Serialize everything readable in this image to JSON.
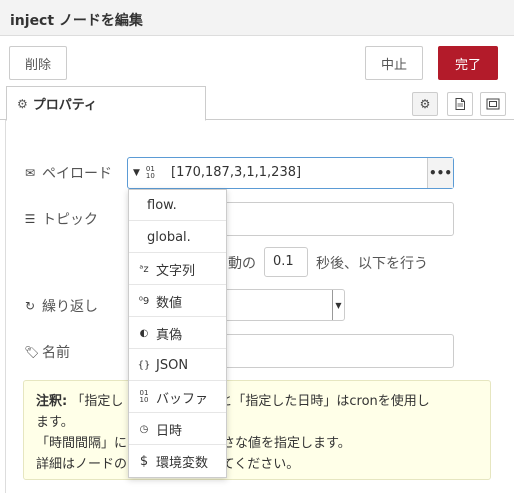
{
  "dialog": {
    "title": "inject ノードを編集"
  },
  "toolbar": {
    "delete_label": "削除",
    "cancel_label": "中止",
    "done_label": "完了"
  },
  "tabs": {
    "properties_label": "プロパティ"
  },
  "form": {
    "payload_label": "ペイロード",
    "payload_value": "[170,187,3,1,1,238]",
    "payload_type_icon": "binary-icon",
    "topic_label": "トピック",
    "delay_prefix": "動の",
    "delay_value": "0.1",
    "delay_suffix": "秒後、以下を行う",
    "repeat_label": "繰り返し",
    "name_label": "名前"
  },
  "note": {
    "bold": "注釈:",
    "line1": "「指定し",
    "line1b": "時」と「指定した日時」はcronを使用し",
    "line2": "ます。",
    "line3": "「時間間隔」に",
    "line3b": "小さな値を指定します。",
    "line4": "詳細はノードの",
    "line4b": "してください。"
  },
  "dropdown": {
    "items": [
      {
        "label": "flow.",
        "icon": ""
      },
      {
        "label": "global.",
        "icon": ""
      },
      {
        "label": "文字列",
        "icon": "string-icon"
      },
      {
        "label": "数値",
        "icon": "number-icon"
      },
      {
        "label": "真偽",
        "icon": "boolean-icon"
      },
      {
        "label": "JSON",
        "icon": "json-icon"
      },
      {
        "label": "バッファ",
        "icon": "buffer-icon"
      },
      {
        "label": "日時",
        "icon": "clock-icon"
      },
      {
        "label": "環境変数",
        "icon": "dollar-icon"
      }
    ]
  },
  "colors": {
    "done_button": "#b31b2a",
    "focus_border": "#5b9bd5",
    "note_bg": "#ffffe8"
  }
}
